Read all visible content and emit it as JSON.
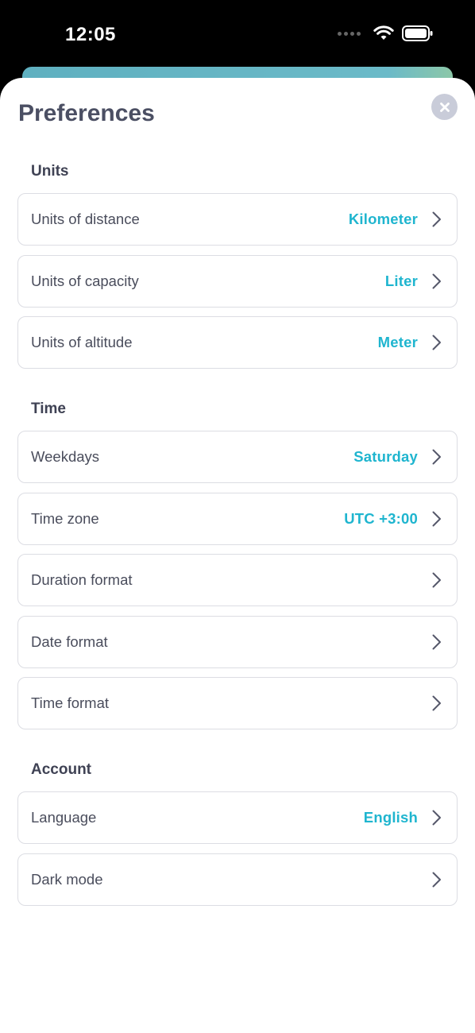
{
  "status_bar": {
    "time": "12:05"
  },
  "sheet": {
    "title": "Preferences"
  },
  "sections": {
    "units": {
      "title": "Units",
      "rows": [
        {
          "label": "Units of distance",
          "value": "Kilometer"
        },
        {
          "label": "Units of capacity",
          "value": "Liter"
        },
        {
          "label": "Units of altitude",
          "value": "Meter"
        }
      ]
    },
    "time": {
      "title": "Time",
      "rows": [
        {
          "label": "Weekdays",
          "value": "Saturday"
        },
        {
          "label": "Time zone",
          "value": "UTC +3:00"
        },
        {
          "label": "Duration format",
          "value": ""
        },
        {
          "label": "Date format",
          "value": ""
        },
        {
          "label": "Time format",
          "value": ""
        }
      ]
    },
    "account": {
      "title": "Account",
      "rows": [
        {
          "label": "Language",
          "value": "English"
        },
        {
          "label": "Dark mode",
          "value": ""
        }
      ]
    }
  },
  "colors": {
    "accent": "#1fb5cf",
    "title": "#4b4f63",
    "row_border": "#dcdde3",
    "close_bg": "#c9ccd9"
  },
  "icons": {
    "close": "close-icon",
    "chevron": "chevron-right-icon",
    "wifi": "wifi-icon",
    "battery": "battery-icon"
  }
}
